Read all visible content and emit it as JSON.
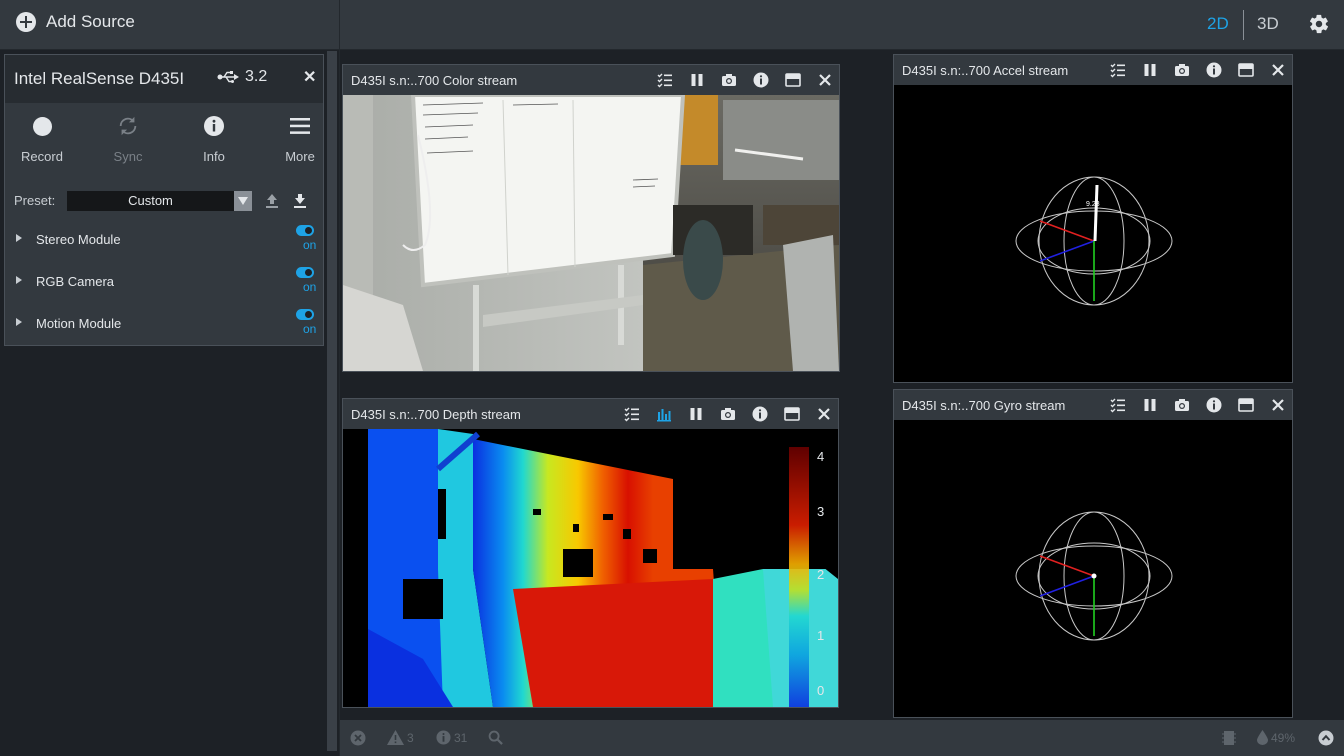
{
  "topbar": {
    "add_source_label": "Add Source",
    "view_2d": "2D",
    "view_3d": "3D",
    "settings_icon": "gear-icon"
  },
  "device": {
    "name": "Intel RealSense D435I",
    "usb_version": "3.2",
    "buttons": [
      {
        "label": "Record",
        "icon": "record-icon",
        "disabled": false
      },
      {
        "label": "Sync",
        "icon": "sync-icon",
        "disabled": true
      },
      {
        "label": "Info",
        "icon": "info-icon",
        "disabled": false
      },
      {
        "label": "More",
        "icon": "menu-icon",
        "disabled": false
      }
    ],
    "preset_label": "Preset:",
    "preset_value": "Custom",
    "modules": [
      {
        "name": "Stereo Module",
        "state": "on"
      },
      {
        "name": "RGB Camera",
        "state": "on"
      },
      {
        "name": "Motion Module",
        "state": "on"
      }
    ]
  },
  "streams": {
    "color": {
      "title": "D435I s.n:..700 Color stream"
    },
    "depth": {
      "title": "D435I s.n:..700 Depth stream",
      "colorbar_ticks": [
        "4",
        "3",
        "2",
        "1",
        "0"
      ]
    },
    "accel": {
      "title": "D435I s.n:..700 Accel stream",
      "readout": "9.23"
    },
    "gyro": {
      "title": "D435I s.n:..700 Gyro stream"
    }
  },
  "bottombar": {
    "warnings_count": "3",
    "info_count": "31",
    "usage": "49%"
  },
  "colors": {
    "accent": "#1ea3e6",
    "panel": "#33393f",
    "background": "#1d2126"
  }
}
